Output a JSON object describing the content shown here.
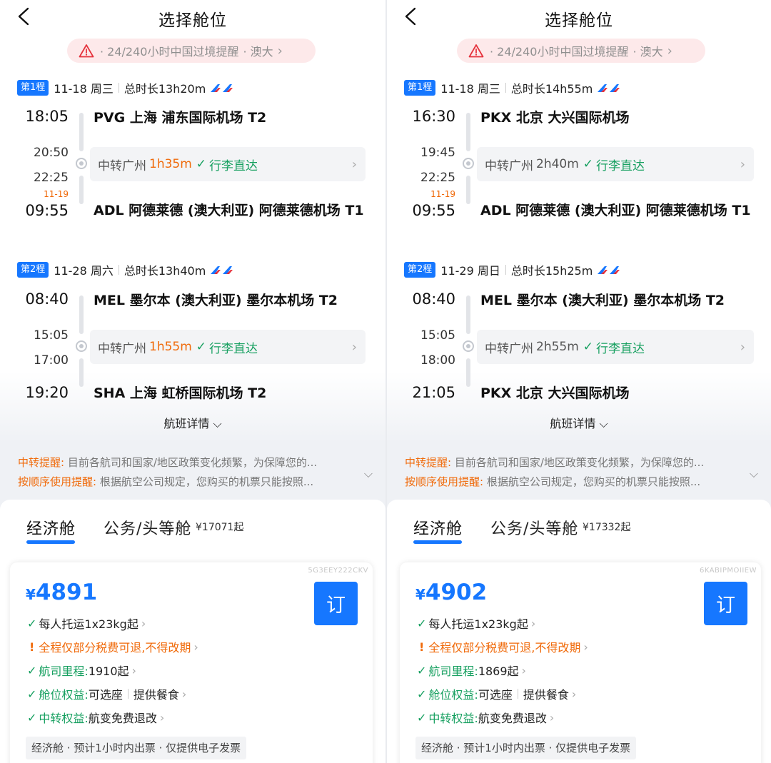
{
  "screens": [
    {
      "header": {
        "title": "选择舱位"
      },
      "notice": {
        "text": "· 24/240小时中国过境提醒",
        "more": "· 澳大"
      },
      "legs": [
        {
          "badge": "第1程",
          "date": "11-18 周三",
          "duration": "总时长13h20m",
          "dep": {
            "time": "18:05",
            "airport": "PVG  上海 浦东国际机场 T2"
          },
          "transfer": {
            "arr_time": "20:50",
            "dep_time": "22:25",
            "label": "中转广州",
            "duration": "1h35m",
            "baggage": "行李直达"
          },
          "arr": {
            "next_day": "11-19",
            "time": "09:55",
            "airport": "ADL  阿德莱德 (澳大利亚) 阿德莱德机场 T1"
          }
        },
        {
          "badge": "第2程",
          "date": "11-28 周六",
          "duration": "总时长13h40m",
          "dep": {
            "time": "08:40",
            "airport": "MEL  墨尔本 (澳大利亚) 墨尔本机场 T2"
          },
          "transfer": {
            "arr_time": "15:05",
            "dep_time": "17:00",
            "label": "中转广州",
            "duration": "1h55m",
            "baggage": "行李直达"
          },
          "arr": {
            "next_day": "",
            "time": "19:20",
            "airport": "SHA  上海 虹桥国际机场 T2"
          }
        }
      ],
      "details_label": "航班详情",
      "reminders": [
        {
          "label": "中转提醒:",
          "text": "目前各航司和国家/地区政策变化频繁，为保障您的..."
        },
        {
          "label": "按顺序使用提醒:",
          "text": "根据航空公司规定，您购买的机票只能按照..."
        }
      ],
      "tabs": {
        "economy": "经济舱",
        "business": "公务/头等舱",
        "business_price": "¥17071起"
      },
      "offer": {
        "code": "5G3EEY222CKV",
        "currency": "¥",
        "price": "4891",
        "book": "订",
        "baggage": "每人托运1x23kg起",
        "refund": "全程仅部分税费可退,不得改期",
        "miles_label": "航司里程:",
        "miles": "1910起",
        "perks_label": "舱位权益:",
        "perk1": "可选座",
        "perk2": "提供餐食",
        "transfer_label": "中转权益:",
        "transfer_perk": "航变免费退改",
        "note": "经济舱 · 预计1小时内出票 · 仅提供电子发票"
      }
    },
    {
      "header": {
        "title": "选择舱位"
      },
      "notice": {
        "text": "· 24/240小时中国过境提醒",
        "more": "· 澳大"
      },
      "legs": [
        {
          "badge": "第1程",
          "date": "11-18 周三",
          "duration": "总时长14h55m",
          "dep": {
            "time": "16:30",
            "airport": "PKX  北京 大兴国际机场"
          },
          "transfer": {
            "arr_time": "19:45",
            "dep_time": "22:25",
            "label": "中转广州",
            "duration": "2h40m",
            "baggage": "行李直达"
          },
          "arr": {
            "next_day": "11-19",
            "time": "09:55",
            "airport": "ADL  阿德莱德 (澳大利亚) 阿德莱德机场 T1"
          }
        },
        {
          "badge": "第2程",
          "date": "11-29 周日",
          "duration": "总时长15h25m",
          "dep": {
            "time": "08:40",
            "airport": "MEL  墨尔本 (澳大利亚) 墨尔本机场 T2"
          },
          "transfer": {
            "arr_time": "15:05",
            "dep_time": "18:00",
            "label": "中转广州",
            "duration": "2h55m",
            "baggage": "行李直达"
          },
          "arr": {
            "next_day": "",
            "time": "21:05",
            "airport": "PKX  北京 大兴国际机场"
          }
        }
      ],
      "details_label": "航班详情",
      "reminders": [
        {
          "label": "中转提醒:",
          "text": "目前各航司和国家/地区政策变化频繁，为保障您的..."
        },
        {
          "label": "按顺序使用提醒:",
          "text": "根据航空公司规定，您购买的机票只能按照..."
        }
      ],
      "tabs": {
        "economy": "经济舱",
        "business": "公务/头等舱",
        "business_price": "¥17332起"
      },
      "offer": {
        "code": "6KABIPMOIIEW",
        "currency": "¥",
        "price": "4902",
        "book": "订",
        "baggage": "每人托运1x23kg起",
        "refund": "全程仅部分税费可退,不得改期",
        "miles_label": "航司里程:",
        "miles": "1869起",
        "perks_label": "舱位权益:",
        "perk1": "可选座",
        "perk2": "提供餐食",
        "transfer_label": "中转权益:",
        "transfer_perk": "航变免费退改",
        "note": "经济舱 · 预计1小时内出票 · 仅提供电子发票"
      }
    }
  ],
  "colors": {
    "accent": "#1677ff",
    "warning": "#f06a0a",
    "success": "#17a060",
    "notice_bg": "#fde9ea"
  },
  "icons": {
    "back": "chevron-left-icon",
    "warning": "warning-triangle-icon",
    "airline": "airline-logo-icon",
    "check": "check-icon"
  }
}
